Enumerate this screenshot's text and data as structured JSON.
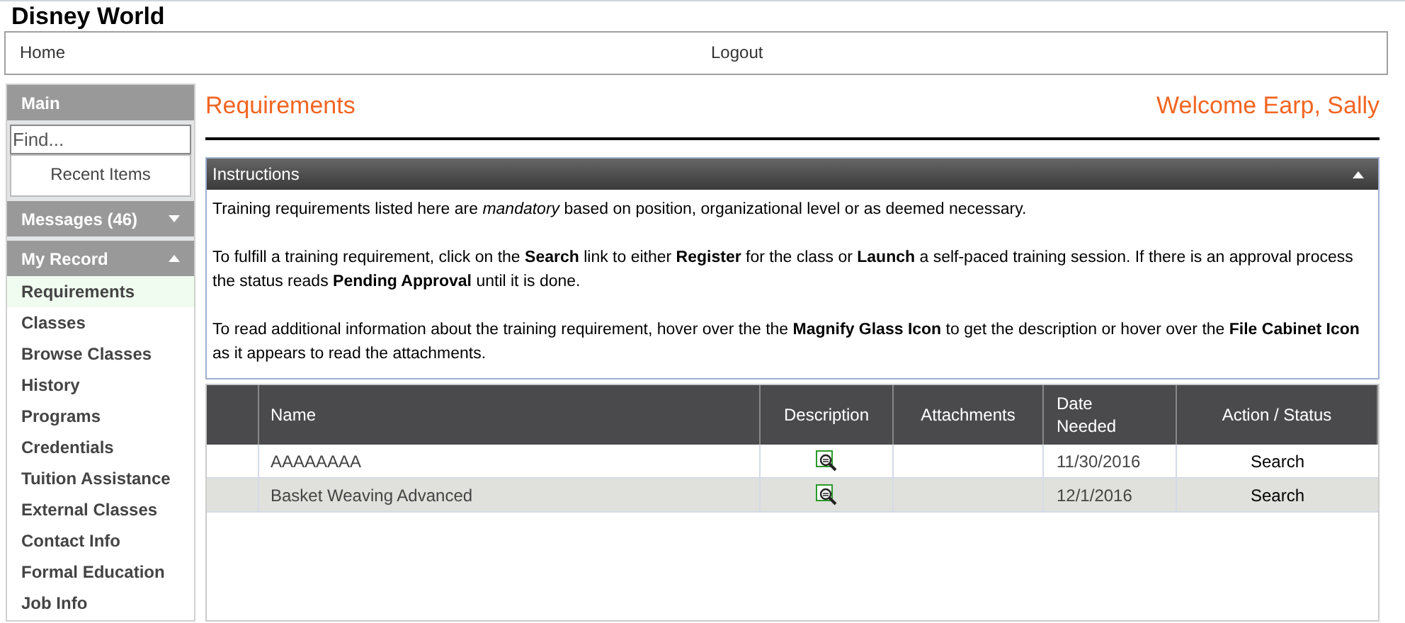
{
  "site_title": "Disney World",
  "nav": [
    "Home",
    "Logout"
  ],
  "sidebar": {
    "main_header": "Main",
    "search": {
      "placeholder": "Find..."
    },
    "recent_items": "Recent Items",
    "sections": [
      {
        "label": "Messages (46)",
        "expanded": false
      },
      {
        "label": "My Record",
        "expanded": true,
        "items": [
          {
            "label": "Requirements",
            "selected": true
          },
          {
            "label": "Classes",
            "selected": false
          },
          {
            "label": "Browse Classes",
            "selected": false
          },
          {
            "label": "History",
            "selected": false
          },
          {
            "label": "Programs",
            "selected": false
          },
          {
            "label": "Credentials",
            "selected": false
          },
          {
            "label": "Tuition Assistance",
            "selected": false
          },
          {
            "label": "External Classes",
            "selected": false
          },
          {
            "label": "Contact Info",
            "selected": false
          },
          {
            "label": "Formal Education",
            "selected": false
          },
          {
            "label": "Job Info",
            "selected": false
          }
        ]
      }
    ]
  },
  "page_title": "Requirements",
  "welcome": "Welcome Earp, Sally",
  "instructions": {
    "title": "Instructions",
    "expanded": true,
    "paragraphs": [
      "Training requirements listed here are *mandatory* based on position, organizational level or as deemed necessary.",
      "To fulfill a training requirement, click on the **Search** link to either **Register** for the class or **Launch** a self-paced training session.  If there is an approval process the status reads **Pending Approval** until it is done.",
      "To read additional information about the training requirement, hover over the the **Magnify Glass Icon** to get the description or hover over the **File Cabinet Icon** as it appears to read the attachments."
    ]
  },
  "table": {
    "columns": [
      "Name",
      "Description",
      "Attachments",
      "Date\nNeeded",
      "Action / Status"
    ],
    "rows": [
      {
        "name": "AAAAAAAA",
        "date_needed": "11/30/2016",
        "action": "Search"
      },
      {
        "name": "Basket Weaving Advanced",
        "date_needed": "12/1/2016",
        "action": "Search"
      }
    ]
  }
}
